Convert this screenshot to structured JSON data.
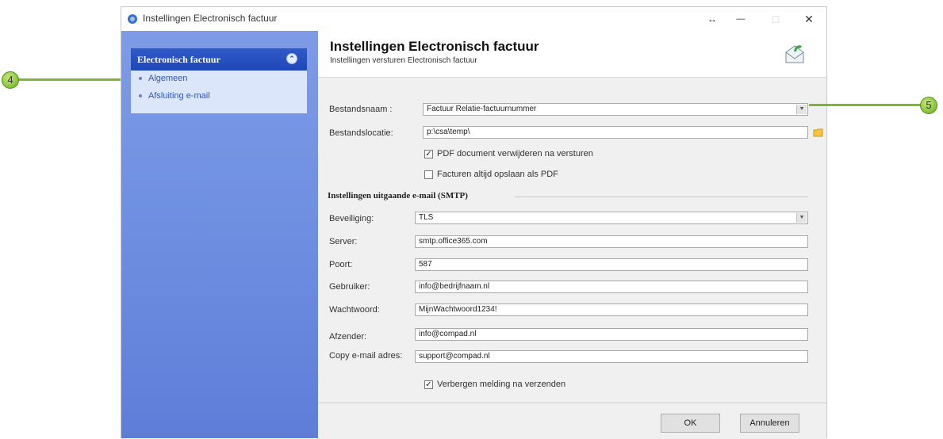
{
  "window": {
    "title": "Instellingen Electronisch factuur",
    "controls": {
      "restore": "↔",
      "minimize": "—",
      "maximize": "□",
      "close": "✕"
    }
  },
  "sidebar": {
    "panel_title": "Electronisch factuur",
    "collapse_icon": "⌃",
    "items": [
      {
        "label": "Algemeen"
      },
      {
        "label": "Afsluiting e-mail"
      }
    ]
  },
  "header": {
    "title": "Instellingen Electronisch factuur",
    "subtitle": "Instellingen versturen Electronisch factuur",
    "icon": "envelope-icon"
  },
  "form": {
    "bestandsnaam": {
      "label": "Bestandsnaam :",
      "value": "Factuur Relatie-factuurnummer"
    },
    "bestandslocatie": {
      "label": "Bestandslocatie:",
      "value": "p:\\csa\\temp\\"
    },
    "pdf_verwijderen": {
      "label": "PDF document verwijderen na versturen",
      "checked": true
    },
    "facturen_opslaan": {
      "label": "Facturen altijd opslaan als PDF",
      "checked": false
    },
    "section_smtp": "Instellingen uitgaande e-mail (SMTP)",
    "beveiliging": {
      "label": "Beveiliging:",
      "value": "TLS"
    },
    "server": {
      "label": "Server:",
      "value": "smtp.office365.com"
    },
    "poort": {
      "label": "Poort:",
      "value": "587"
    },
    "gebruiker": {
      "label": "Gebruiker:",
      "value": "info@bedrijfnaam.nl"
    },
    "wachtwoord": {
      "label": "Wachtwoord:",
      "value": "MijnWachtwoord1234!"
    },
    "afzender": {
      "label": "Afzender:",
      "value": "info@compad.nl"
    },
    "copy_email": {
      "label": "Copy e-mail adres:",
      "value": "support@compad.nl"
    },
    "verbergen_melding": {
      "label": "Verbergen melding na verzenden",
      "checked": true
    }
  },
  "footer": {
    "ok_label": "OK",
    "cancel_label": "Annuleren"
  },
  "callouts": {
    "left": "4",
    "right": "5"
  },
  "colors": {
    "sidebar": "#6b8be0",
    "panel_header": "#2650c2",
    "callout": "#8cc63f"
  }
}
